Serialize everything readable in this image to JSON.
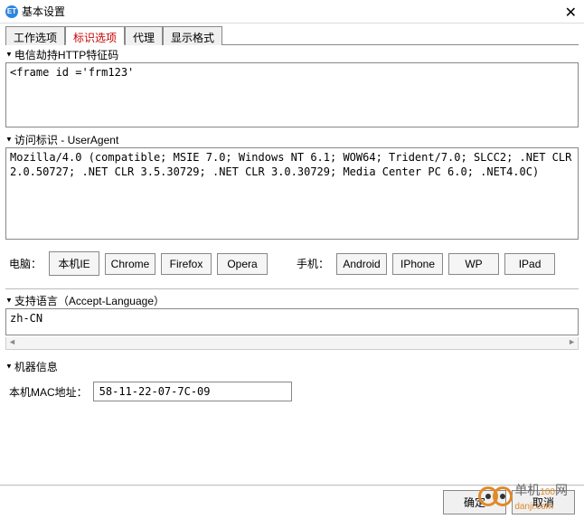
{
  "window": {
    "title": "基本设置",
    "icon_text": "ET"
  },
  "tabs": [
    {
      "label": "工作选项",
      "active": false
    },
    {
      "label": "标识选项",
      "active": true
    },
    {
      "label": "代理",
      "active": false
    },
    {
      "label": "显示格式",
      "active": false
    }
  ],
  "sections": {
    "http_hijack": {
      "label": "电信劫持HTTP特征码",
      "value": "<frame id ='frm123'"
    },
    "user_agent": {
      "label": "访问标识 - UserAgent",
      "value": "Mozilla/4.0 (compatible; MSIE 7.0; Windows NT 6.1; WOW64; Trident/7.0; SLCC2; .NET CLR 2.0.50727; .NET CLR 3.5.30729; .NET CLR 3.0.30729; Media Center PC 6.0; .NET4.0C)"
    },
    "buttons": {
      "pc_label": "电脑：",
      "pc": [
        "本机IE",
        "Chrome",
        "Firefox",
        "Opera"
      ],
      "mobile_label": "手机：",
      "mobile": [
        "Android",
        "IPhone",
        "WP",
        "IPad"
      ]
    },
    "accept_language": {
      "label": "支持语言（Accept-Language）",
      "value": "zh-CN"
    },
    "machine": {
      "label": "机器信息",
      "mac_label": "本机MAC地址：",
      "mac_value": "58-11-22-07-7C-09"
    }
  },
  "footer": {
    "ok": "确定",
    "cancel": "取消"
  },
  "watermark": {
    "line1": "单机",
    "line2": "danji",
    "line3": "100",
    "line4": "网",
    "line5": ".com"
  }
}
